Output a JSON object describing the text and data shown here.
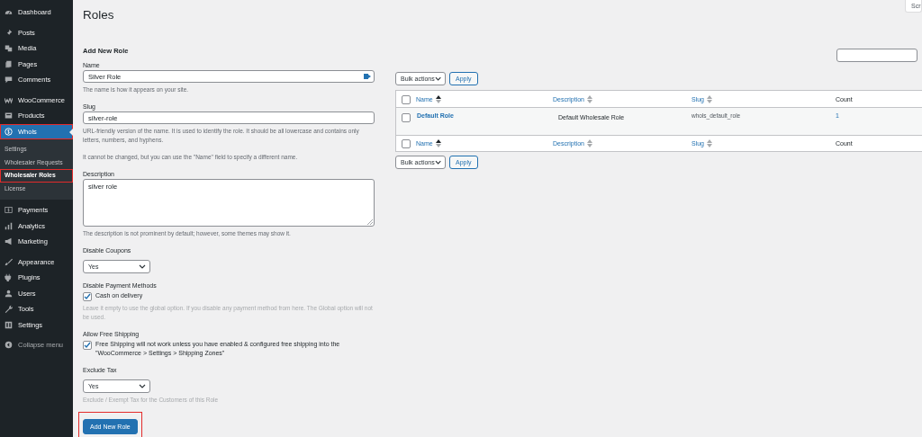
{
  "sidebar": {
    "groups": [
      [
        {
          "label": "Dashboard",
          "selected": false,
          "highlighted": false
        }
      ],
      [
        {
          "label": "Posts",
          "selected": false,
          "highlighted": false
        },
        {
          "label": "Media",
          "selected": false,
          "highlighted": false
        },
        {
          "label": "Pages",
          "selected": false,
          "highlighted": false
        },
        {
          "label": "Comments",
          "selected": false,
          "highlighted": false
        }
      ],
      [
        {
          "label": "WooCommerce",
          "selected": false,
          "highlighted": false
        },
        {
          "label": "Products",
          "selected": false,
          "highlighted": false
        },
        {
          "label": "Whols",
          "selected": true,
          "highlighted": true,
          "submenu": [
            {
              "label": "Settings",
              "selected": false,
              "highlighted": false
            },
            {
              "label": "Wholesaler Requests",
              "selected": false,
              "highlighted": false
            },
            {
              "label": "Wholesaler Roles",
              "selected": true,
              "highlighted": true
            },
            {
              "label": "License",
              "selected": false,
              "highlighted": false
            }
          ]
        },
        {
          "label": "Payments",
          "selected": false,
          "highlighted": false
        },
        {
          "label": "Analytics",
          "selected": false,
          "highlighted": false
        },
        {
          "label": "Marketing",
          "selected": false,
          "highlighted": false
        }
      ],
      [
        {
          "label": "Appearance",
          "selected": false,
          "highlighted": false
        },
        {
          "label": "Plugins",
          "selected": false,
          "highlighted": false
        },
        {
          "label": "Users",
          "selected": false,
          "highlighted": false
        },
        {
          "label": "Tools",
          "selected": false,
          "highlighted": false
        },
        {
          "label": "Settings",
          "selected": false,
          "highlighted": false
        }
      ]
    ],
    "collapse": "Collapse menu"
  },
  "screen_options": "Scr",
  "page_title": "Roles",
  "form": {
    "heading": "Add New Role",
    "fields": [
      {
        "kind": "text",
        "label": "Name",
        "value": "Silver Role",
        "help": [
          "The name is how it appears on your site."
        ]
      },
      {
        "kind": "text",
        "label": "Slug",
        "value": "silver-role",
        "help": [
          "URL-friendly version of the name. It is used to identify the role. It should be all lowercase and contains only letters, numbers, and hyphens.",
          "It cannot be changed, but you can use the \"Name\" field to specify a different name."
        ]
      },
      {
        "kind": "textarea",
        "label": "Description",
        "value": "silver role",
        "help": [
          "The description is not prominent by default; however, some themes may show it."
        ]
      },
      {
        "kind": "select",
        "label": "Disable Coupons",
        "value": "Yes"
      },
      {
        "kind": "checkbox",
        "label": "Disable Payment Methods",
        "options": [
          {
            "label": "Cash on delivery",
            "checked": true
          }
        ],
        "help": [
          "Leave it empty to use the global option. If you disable any payment method from here. The Global option will not be used."
        ]
      },
      {
        "kind": "checkbox",
        "label": "Allow Free Shipping",
        "options": [
          {
            "label": "Free Shipping will not work unless you have enabled & configured free shipping into the \"WooCommerce > Settings > Shipping Zones\"",
            "checked": true
          }
        ]
      },
      {
        "kind": "select",
        "label": "Exclude Tax",
        "value": "Yes",
        "help": [
          "Exclude / Exempt Tax for the Customers of this Role"
        ]
      }
    ],
    "submit": {
      "label": "Add New Role",
      "highlighted": true
    }
  },
  "table": {
    "bulk_top": {
      "action": "Bulk actions",
      "apply": "Apply"
    },
    "header_checked": false,
    "columns": [
      {
        "label": "Name",
        "sortable": true,
        "sorted": true
      },
      {
        "label": "Description",
        "sortable": true,
        "sorted": false
      },
      {
        "label": "Slug",
        "sortable": true,
        "sorted": false
      },
      {
        "label": "Count",
        "sortable": false
      }
    ],
    "rows": [
      {
        "name": "Default Role",
        "description": "Default Wholesale Role",
        "slug": "whols_default_role",
        "count": "1",
        "checked": false
      }
    ],
    "footer_checked": false,
    "footer_columns": [
      {
        "label": "Name",
        "sortable": true,
        "sorted": true
      },
      {
        "label": "Description",
        "sortable": true,
        "sorted": false
      },
      {
        "label": "Slug",
        "sortable": true,
        "sorted": false
      },
      {
        "label": "Count",
        "sortable": false
      }
    ],
    "bulk_bottom": {
      "action": "Bulk actions",
      "apply": "Apply"
    }
  }
}
